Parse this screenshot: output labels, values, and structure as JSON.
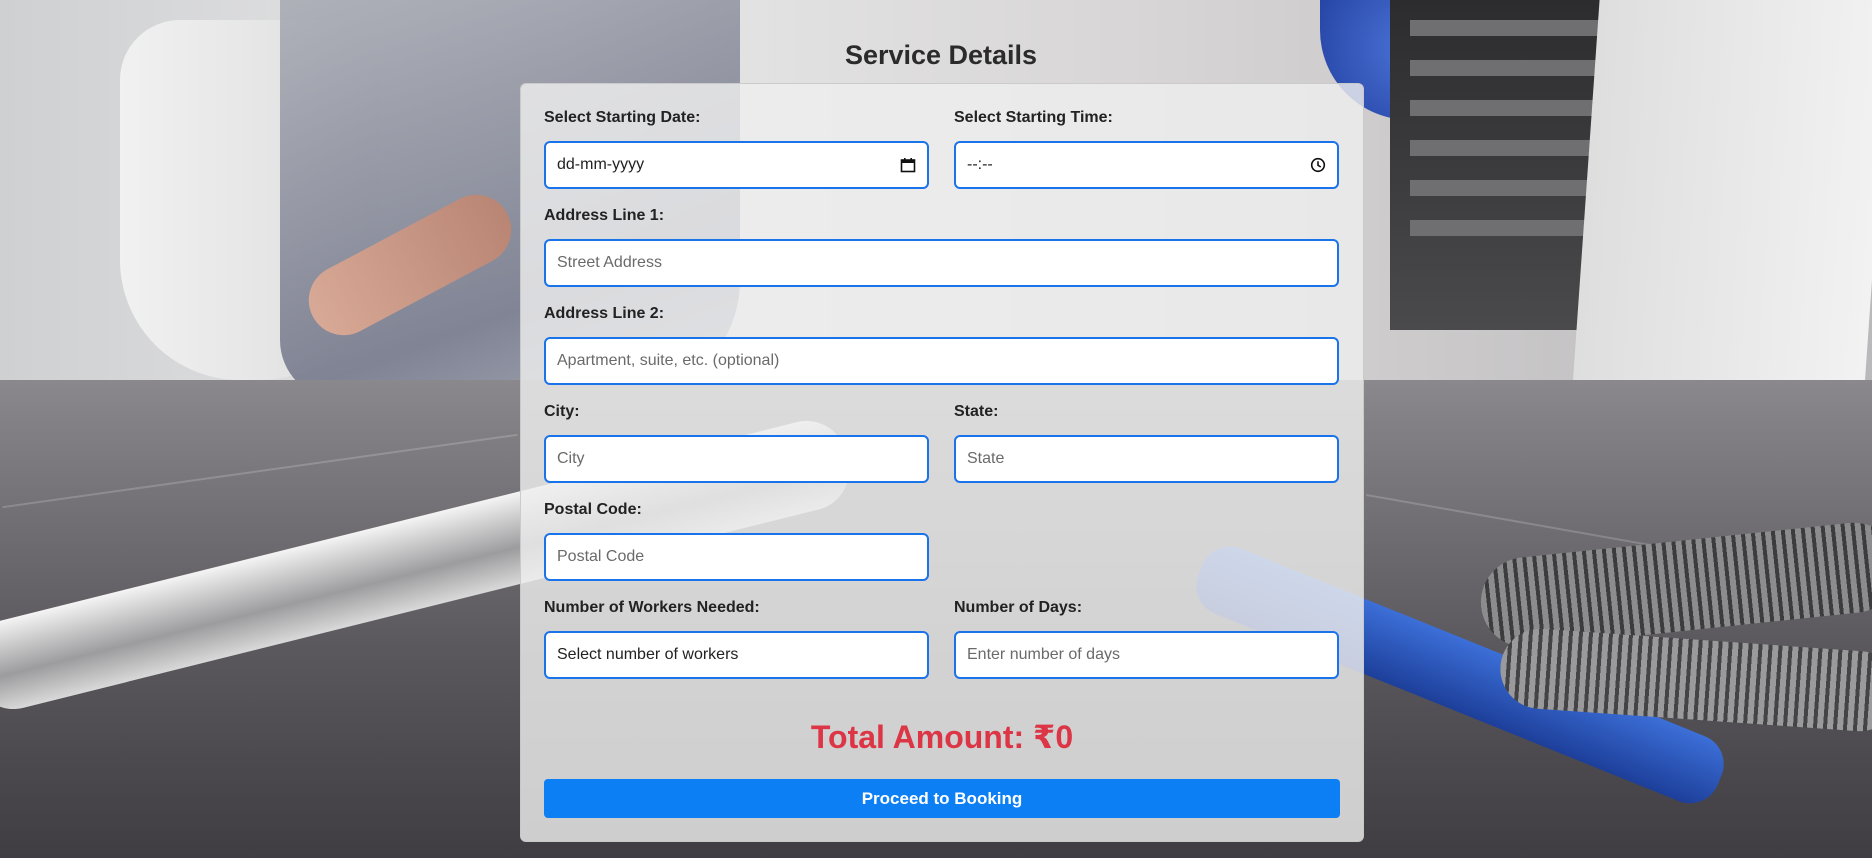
{
  "page": {
    "title": "Service Details"
  },
  "form": {
    "start_date": {
      "label": "Select Starting Date:",
      "value": "dd-mm-yyyy",
      "icon": "calendar-icon"
    },
    "start_time": {
      "label": "Select Starting Time:",
      "value": "--:--",
      "icon": "clock-icon"
    },
    "address1": {
      "label": "Address Line 1:",
      "placeholder": "Street Address"
    },
    "address2": {
      "label": "Address Line 2:",
      "placeholder": "Apartment, suite, etc. (optional)"
    },
    "city": {
      "label": "City:",
      "placeholder": "City"
    },
    "state": {
      "label": "State:",
      "placeholder": "State"
    },
    "postal": {
      "label": "Postal Code:",
      "placeholder": "Postal Code"
    },
    "workers": {
      "label": "Number of Workers Needed:",
      "value": "Select number of workers"
    },
    "days": {
      "label": "Number of Days:",
      "placeholder": "Enter number of days"
    }
  },
  "summary": {
    "total": "Total Amount: ₹0"
  },
  "actions": {
    "proceed_label": "Proceed to Booking"
  },
  "colors": {
    "accent": "#0d7ff5",
    "input_border": "#1a73e8",
    "total": "#dc3545"
  }
}
